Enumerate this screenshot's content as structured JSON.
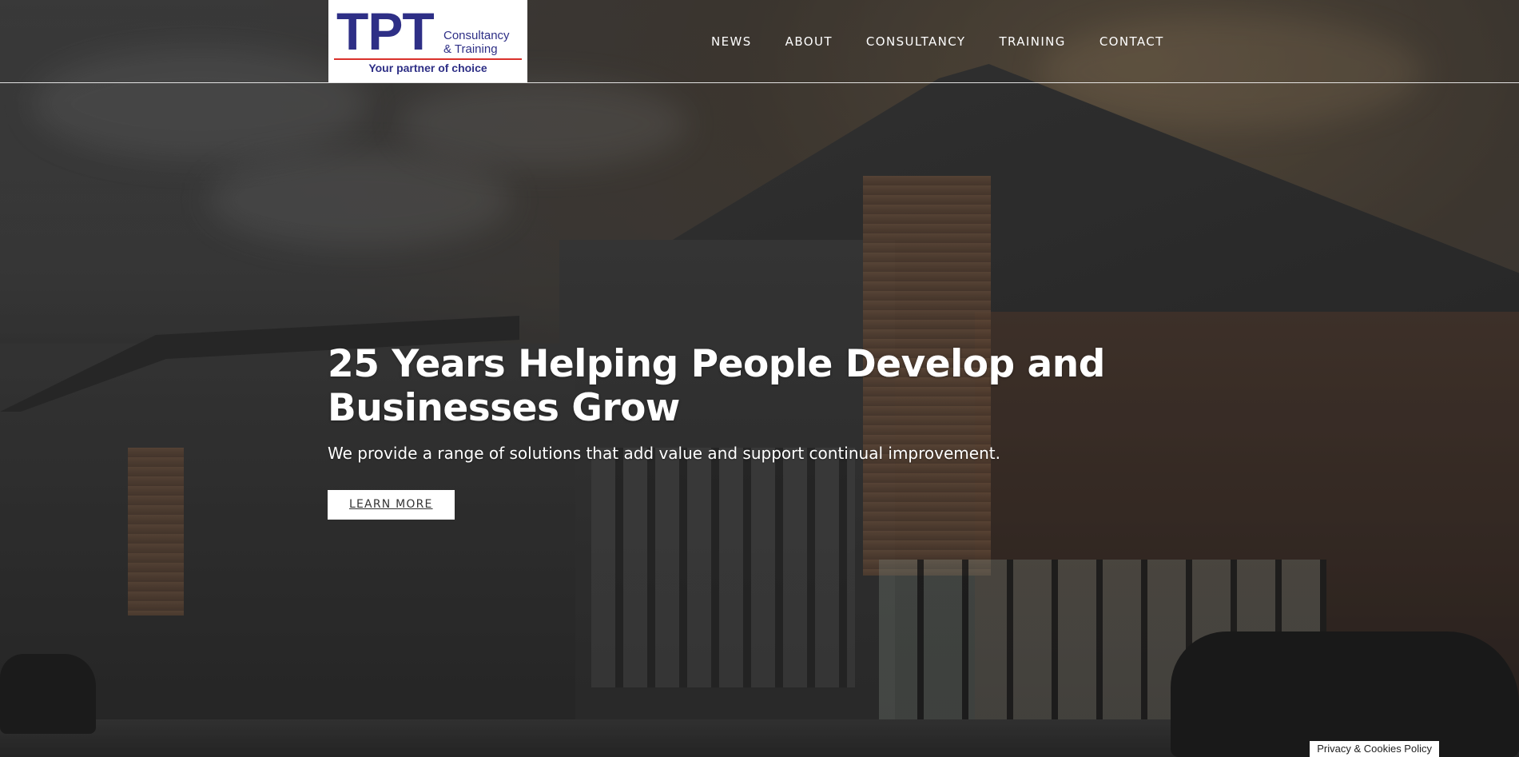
{
  "logo": {
    "brand": "TPT",
    "subtitle_line1": "Consultancy",
    "subtitle_line2": "& Training",
    "tagline": "Your partner of choice"
  },
  "nav": {
    "items": [
      {
        "label": "NEWS"
      },
      {
        "label": "ABOUT"
      },
      {
        "label": "CONSULTANCY"
      },
      {
        "label": "TRAINING"
      },
      {
        "label": "CONTACT"
      }
    ]
  },
  "hero": {
    "headline_line1": "25 Years Helping People Develop and",
    "headline_line2": "Businesses Grow",
    "subline": "We provide a range of solutions that add value and support continual improvement.",
    "cta_label": "LEARN MORE"
  },
  "footer": {
    "privacy_label": "Privacy & Cookies Policy"
  },
  "colors": {
    "brand_blue": "#2e2f86",
    "brand_red": "#d9312b",
    "text_white": "#ffffff"
  }
}
